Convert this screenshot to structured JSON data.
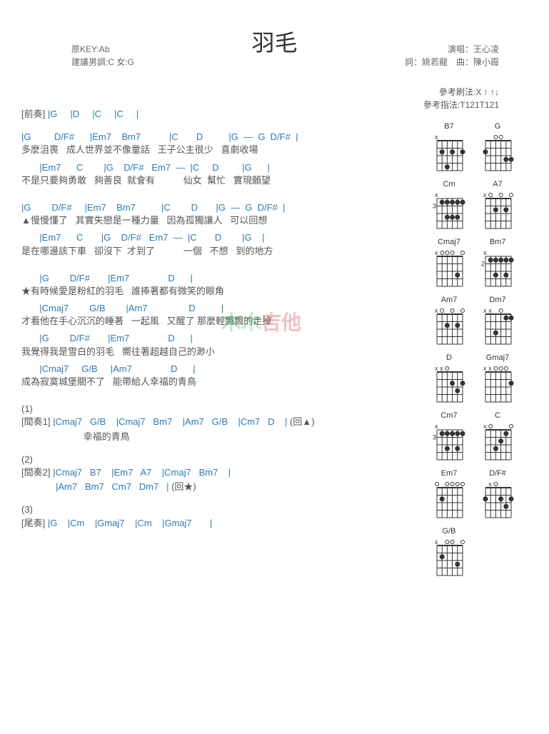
{
  "title": "羽毛",
  "meta_left": {
    "key": "原KEY:Ab",
    "suggest": "建議男調:C 女:G"
  },
  "meta_right": {
    "singer": "演唱：王心凌",
    "credit": "詞：姚若龍　曲：陳小霞"
  },
  "pattern": {
    "strum": "參考刷法:X ↑ ↑↓",
    "finger": "參考指法:T121T121"
  },
  "sections": {
    "intro": {
      "label": "[前奏]",
      "chords": "|G     |D     |C     |C     |"
    },
    "v1": [
      {
        "c": "|G         D/F#      |Em7    Bm7           |C       D          |G  —  G  D/F#  |",
        "l": "多麼沮喪   成人世界並不像童話   王子公主很少   喜劇收場"
      },
      {
        "c": "       |Em7      C        |G    D/F#   Em7  —  |C     D         |G      |",
        "l": "不是只要夠勇敢   夠善良  就會有           仙女  幫忙   實現願望"
      }
    ],
    "v2": [
      {
        "c": "|G        D/F#     |Em7    Bm7          |C        D       |G  —  G  D/F#  |",
        "l": "▲慢慢懂了   其實失戀是一種力量   因為孤獨讓人   可以回想"
      },
      {
        "c": "       |Em7      C       |G    D/F#   Em7  —  |C       D        |G    |",
        "l": "是在哪邊該下車   卻沒下  才到了           一個   不想   到的地方"
      }
    ],
    "chorus": [
      {
        "c": "       |G        D/F#       |Em7               D      |",
        "l": "★有時候愛是粉紅的羽毛   誰捧著都有微笑的眼角"
      },
      {
        "c": "       |Cmaj7        G/B        |Am7                D          |",
        "l": "才看他在手心沉沉的睡著   一起風   又醒了 那麼輕飄飄的走掉"
      },
      {
        "c": "       |G        D/F#       |Em7               D      |",
        "l": "我覺得我是雪白的羽毛   嚮往著超越自己的渺小"
      },
      {
        "c": "       |Cmaj7     G/B     |Am7               D      |",
        "l": "成為寂寞城堡關不了   能帶給人幸福的青鳥"
      }
    ],
    "inter1": {
      "num": "(1)",
      "label": "[間奏1]",
      "c": "|Cmaj7   G/B    |Cmaj7   Bm7    |Am7   G/B    |Cm7   D    |",
      "l": "                        幸福的青鳥",
      "ret": "(回▲)"
    },
    "inter2": {
      "num": "(2)",
      "label": "[間奏2]",
      "c1": "|Cmaj7   B7    |Em7   A7    |Cmaj7   Bm7    |",
      "c2": "|Am7   Bm7   Cm7   Dm7   |",
      "ret": "(回★)"
    },
    "outro": {
      "num": "(3)",
      "label": "[尾奏]",
      "c": "|G    |Cm    |Gmaj7    |Cm    |Gmaj7       |"
    }
  },
  "chord_diagrams": [
    "B7",
    "G",
    "Cm",
    "A7",
    "Cmaj7",
    "Bm7",
    "Am7",
    "Dm7",
    "D",
    "Gmaj7",
    "Cm7",
    "C",
    "Em7",
    "D/F#",
    "G/B"
  ],
  "chord_data": {
    "B7": {
      "f": "",
      "x": [
        0
      ],
      "o": [],
      "d": [
        [
          1,
          1
        ],
        [
          3,
          1
        ],
        [
          5,
          1
        ],
        [
          2,
          3
        ]
      ]
    },
    "G": {
      "f": "",
      "x": [],
      "o": [
        2,
        3
      ],
      "d": [
        [
          0,
          1
        ],
        [
          4,
          2
        ],
        [
          5,
          2
        ]
      ]
    },
    "Cm": {
      "f": "3",
      "x": [
        0
      ],
      "o": [],
      "d": [
        [
          1,
          0
        ],
        [
          2,
          0
        ],
        [
          3,
          0
        ],
        [
          4,
          0
        ],
        [
          5,
          0
        ],
        [
          2,
          2
        ],
        [
          3,
          2
        ],
        [
          4,
          2
        ]
      ]
    },
    "A7": {
      "f": "",
      "x": [
        0
      ],
      "o": [
        1,
        3,
        5
      ],
      "d": [
        [
          2,
          1
        ],
        [
          4,
          1
        ]
      ]
    },
    "Cmaj7": {
      "f": "",
      "x": [
        0
      ],
      "o": [
        1,
        2,
        3,
        5
      ],
      "d": [
        [
          4,
          2
        ]
      ]
    },
    "Bm7": {
      "f": "2",
      "x": [
        0
      ],
      "o": [],
      "d": [
        [
          1,
          0
        ],
        [
          2,
          0
        ],
        [
          3,
          0
        ],
        [
          4,
          0
        ],
        [
          5,
          0
        ],
        [
          2,
          2
        ],
        [
          4,
          2
        ]
      ]
    },
    "Am7": {
      "f": "",
      "x": [
        0
      ],
      "o": [
        1,
        3,
        5
      ],
      "d": [
        [
          2,
          1
        ],
        [
          4,
          1
        ]
      ]
    },
    "Dm7": {
      "f": "",
      "x": [
        0,
        1
      ],
      "o": [
        3
      ],
      "d": [
        [
          4,
          0
        ],
        [
          5,
          0
        ],
        [
          2,
          2
        ]
      ]
    },
    "D": {
      "f": "",
      "x": [
        0,
        1
      ],
      "o": [
        2
      ],
      "d": [
        [
          3,
          1
        ],
        [
          5,
          1
        ],
        [
          4,
          2
        ]
      ]
    },
    "Gmaj7": {
      "f": "",
      "x": [
        0,
        1
      ],
      "o": [
        2,
        3,
        4
      ],
      "d": [
        [
          5,
          1
        ]
      ]
    },
    "Cm7": {
      "f": "3",
      "x": [
        0
      ],
      "o": [],
      "d": [
        [
          1,
          0
        ],
        [
          2,
          0
        ],
        [
          3,
          0
        ],
        [
          4,
          0
        ],
        [
          5,
          0
        ],
        [
          2,
          2
        ],
        [
          4,
          2
        ]
      ]
    },
    "C": {
      "f": "",
      "x": [
        0
      ],
      "o": [
        1,
        5
      ],
      "d": [
        [
          4,
          0
        ],
        [
          2,
          2
        ],
        [
          3,
          1
        ]
      ]
    },
    "Em7": {
      "f": "",
      "x": [],
      "o": [
        0,
        2,
        3,
        4,
        5
      ],
      "d": [
        [
          1,
          1
        ]
      ]
    },
    "D/F#": {
      "f": "",
      "x": [
        1
      ],
      "o": [
        2
      ],
      "d": [
        [
          0,
          1
        ],
        [
          3,
          1
        ],
        [
          5,
          1
        ],
        [
          4,
          2
        ]
      ]
    },
    "G/B": {
      "f": "",
      "x": [
        0
      ],
      "o": [
        2,
        3,
        5
      ],
      "d": [
        [
          1,
          1
        ],
        [
          4,
          2
        ]
      ]
    }
  },
  "watermark": "木木吉他"
}
